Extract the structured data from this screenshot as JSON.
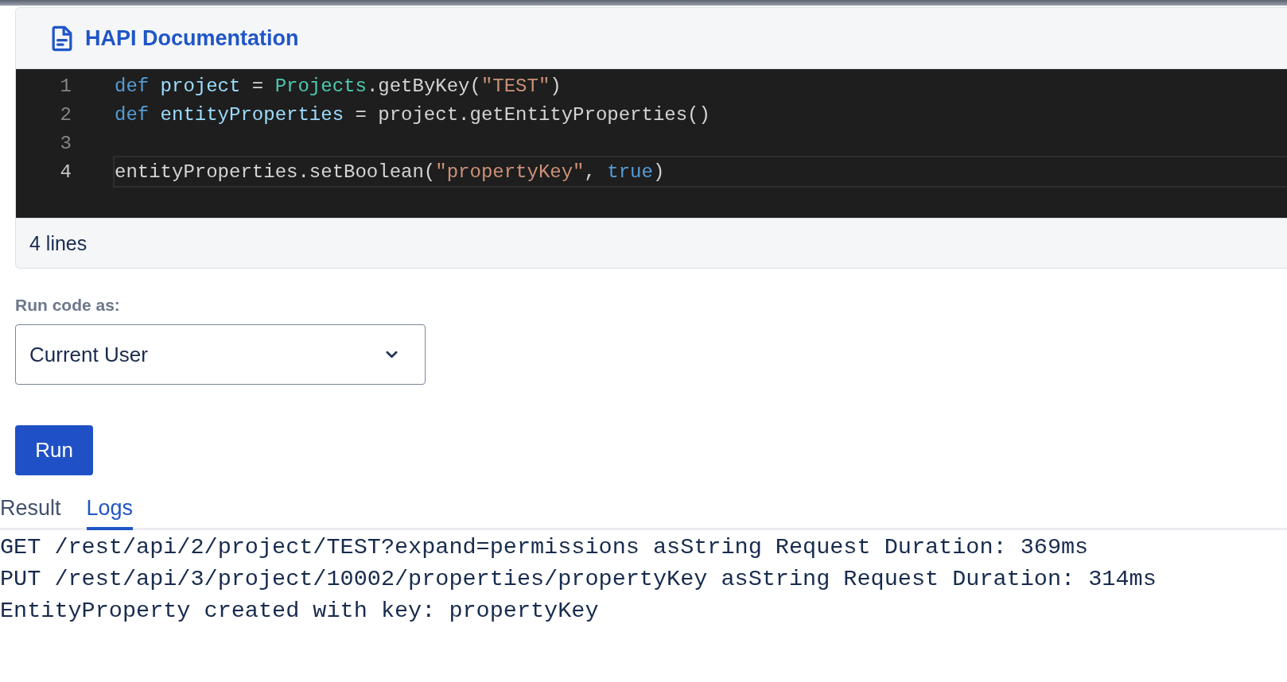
{
  "editor": {
    "title": "HAPI Documentation",
    "lines": [
      {
        "number": "1",
        "current": false,
        "tokens": [
          {
            "kind": "keyword",
            "text": "def "
          },
          {
            "kind": "variable",
            "text": "project"
          },
          {
            "kind": "plain",
            "text": " = "
          },
          {
            "kind": "class",
            "text": "Projects"
          },
          {
            "kind": "plain",
            "text": ".getByKey("
          },
          {
            "kind": "string",
            "text": "\"TEST\""
          },
          {
            "kind": "plain",
            "text": ")"
          }
        ]
      },
      {
        "number": "2",
        "current": false,
        "tokens": [
          {
            "kind": "keyword",
            "text": "def "
          },
          {
            "kind": "variable",
            "text": "entityProperties"
          },
          {
            "kind": "plain",
            "text": " = project.getEntityProperties()"
          }
        ]
      },
      {
        "number": "3",
        "current": false
      },
      {
        "number": "4",
        "current": true,
        "tokens": [
          {
            "kind": "plain",
            "text": "entityProperties.setBoolean("
          },
          {
            "kind": "string",
            "text": "\"propertyKey\""
          },
          {
            "kind": "plain",
            "text": ", "
          },
          {
            "kind": "keyword",
            "text": "true"
          },
          {
            "kind": "plain",
            "text": ")"
          }
        ]
      }
    ],
    "footer": "4 lines"
  },
  "run_as": {
    "label": "Run code as:",
    "value": "Current User"
  },
  "run_button": "Run",
  "tabs": [
    {
      "label": "Result",
      "selected": false
    },
    {
      "label": "Logs",
      "selected": true
    }
  ],
  "logs": [
    "GET /rest/api/2/project/TEST?expand=permissions asString Request Duration: 369ms",
    "PUT /rest/api/3/project/10002/properties/propertyKey asString Request Duration: 314ms",
    "EntityProperty created with key: propertyKey"
  ]
}
